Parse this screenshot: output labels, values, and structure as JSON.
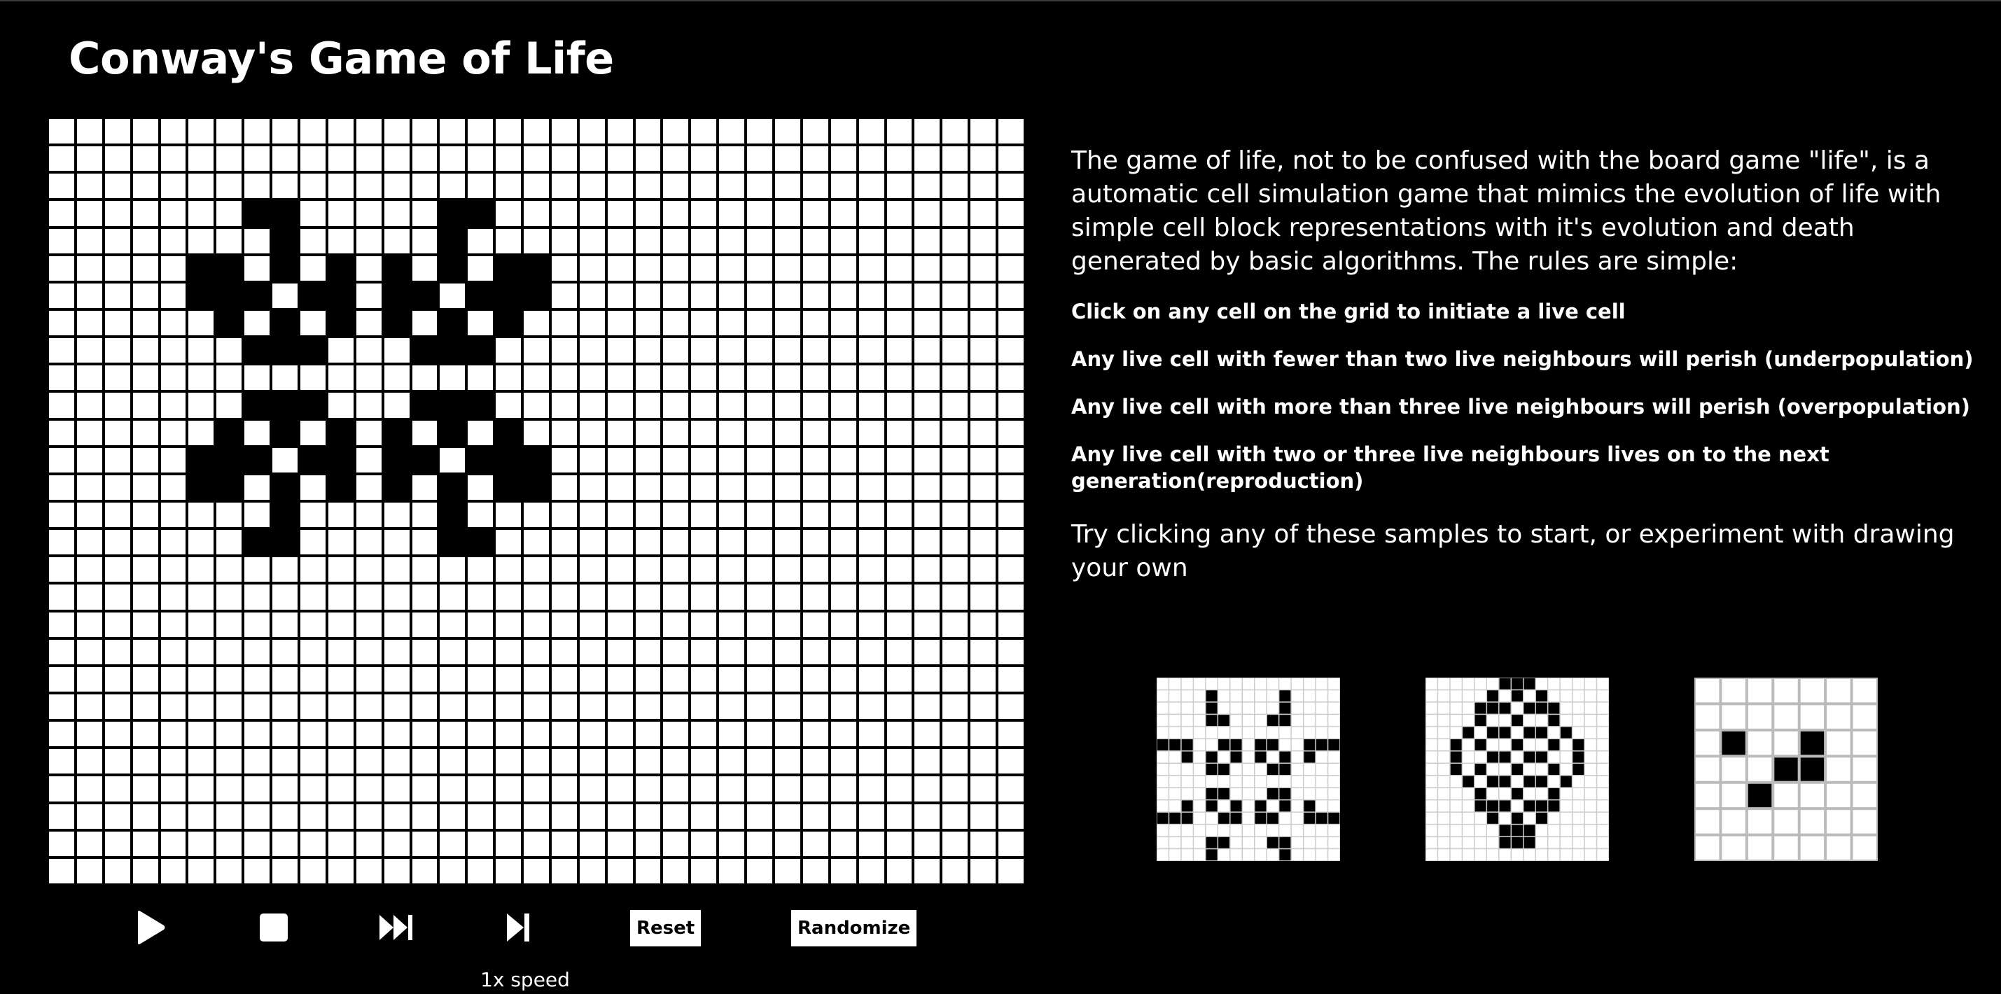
{
  "app": {
    "title": "Conway's Game of Life"
  },
  "board": {
    "cols": 35,
    "rows": 28,
    "live_cells": [
      [
        3,
        7
      ],
      [
        3,
        8
      ],
      [
        3,
        14
      ],
      [
        3,
        15
      ],
      [
        4,
        8
      ],
      [
        4,
        14
      ],
      [
        5,
        5
      ],
      [
        5,
        6
      ],
      [
        5,
        8
      ],
      [
        5,
        10
      ],
      [
        5,
        12
      ],
      [
        5,
        14
      ],
      [
        5,
        16
      ],
      [
        5,
        17
      ],
      [
        6,
        5
      ],
      [
        6,
        6
      ],
      [
        6,
        7
      ],
      [
        6,
        9
      ],
      [
        6,
        10
      ],
      [
        6,
        12
      ],
      [
        6,
        13
      ],
      [
        6,
        15
      ],
      [
        6,
        16
      ],
      [
        6,
        17
      ],
      [
        7,
        6
      ],
      [
        7,
        8
      ],
      [
        7,
        10
      ],
      [
        7,
        12
      ],
      [
        7,
        14
      ],
      [
        7,
        16
      ],
      [
        8,
        7
      ],
      [
        8,
        8
      ],
      [
        8,
        9
      ],
      [
        8,
        13
      ],
      [
        8,
        14
      ],
      [
        8,
        15
      ],
      [
        10,
        7
      ],
      [
        10,
        8
      ],
      [
        10,
        9
      ],
      [
        10,
        13
      ],
      [
        10,
        14
      ],
      [
        10,
        15
      ],
      [
        11,
        6
      ],
      [
        11,
        8
      ],
      [
        11,
        10
      ],
      [
        11,
        12
      ],
      [
        11,
        14
      ],
      [
        11,
        16
      ],
      [
        12,
        5
      ],
      [
        12,
        6
      ],
      [
        12,
        7
      ],
      [
        12,
        9
      ],
      [
        12,
        10
      ],
      [
        12,
        12
      ],
      [
        12,
        13
      ],
      [
        12,
        15
      ],
      [
        12,
        16
      ],
      [
        12,
        17
      ],
      [
        13,
        5
      ],
      [
        13,
        6
      ],
      [
        13,
        8
      ],
      [
        13,
        10
      ],
      [
        13,
        12
      ],
      [
        13,
        14
      ],
      [
        13,
        16
      ],
      [
        13,
        17
      ],
      [
        14,
        8
      ],
      [
        14,
        14
      ],
      [
        15,
        7
      ],
      [
        15,
        8
      ],
      [
        15,
        14
      ],
      [
        15,
        15
      ]
    ]
  },
  "controls": {
    "play_icon": "play-icon",
    "stop_icon": "stop-icon",
    "fast_forward_icon": "fast-forward-icon",
    "step_icon": "step-forward-icon",
    "reset_label": "Reset",
    "randomize_label": "Randomize",
    "speed_label": "1x speed"
  },
  "info": {
    "intro": "The game of life, not to be confused with the board game \"life\", is a automatic cell simulation game that mimics the evolution of life with simple cell block representations with it's evolution and death generated by basic algorithms. The rules are simple:",
    "rules": [
      "Click on any cell on the grid to initiate a live cell",
      "Any live cell with fewer than two live neighbours will perish (underpopulation)",
      "Any live cell with more than three live neighbours will perish (overpopulation)",
      "Any live cell with two or three live neighbours lives on to the next generation(reproduction)"
    ],
    "try_text": "Try clicking any of these samples to start, or experiment with drawing your own"
  },
  "samples": [
    {
      "name": "sample-pulsar",
      "cols": 15,
      "rows": 15,
      "grid_color": "#cccccc",
      "live_cells": [
        [
          1,
          4
        ],
        [
          1,
          10
        ],
        [
          2,
          4
        ],
        [
          2,
          10
        ],
        [
          3,
          4
        ],
        [
          3,
          5
        ],
        [
          3,
          9
        ],
        [
          3,
          10
        ],
        [
          5,
          0
        ],
        [
          5,
          1
        ],
        [
          5,
          2
        ],
        [
          5,
          5
        ],
        [
          5,
          6
        ],
        [
          5,
          8
        ],
        [
          5,
          9
        ],
        [
          5,
          12
        ],
        [
          5,
          13
        ],
        [
          5,
          14
        ],
        [
          6,
          2
        ],
        [
          6,
          4
        ],
        [
          6,
          6
        ],
        [
          6,
          8
        ],
        [
          6,
          10
        ],
        [
          6,
          12
        ],
        [
          7,
          4
        ],
        [
          7,
          5
        ],
        [
          7,
          9
        ],
        [
          7,
          10
        ],
        [
          9,
          4
        ],
        [
          9,
          5
        ],
        [
          9,
          9
        ],
        [
          9,
          10
        ],
        [
          10,
          2
        ],
        [
          10,
          4
        ],
        [
          10,
          6
        ],
        [
          10,
          8
        ],
        [
          10,
          10
        ],
        [
          10,
          12
        ],
        [
          11,
          0
        ],
        [
          11,
          1
        ],
        [
          11,
          2
        ],
        [
          11,
          5
        ],
        [
          11,
          6
        ],
        [
          11,
          8
        ],
        [
          11,
          9
        ],
        [
          11,
          12
        ],
        [
          11,
          13
        ],
        [
          11,
          14
        ],
        [
          13,
          4
        ],
        [
          13,
          5
        ],
        [
          13,
          9
        ],
        [
          13,
          10
        ],
        [
          14,
          4
        ],
        [
          14,
          10
        ]
      ]
    },
    {
      "name": "sample-pentadecathlon",
      "cols": 15,
      "rows": 15,
      "grid_color": "#cccccc",
      "live_cells": [
        [
          0,
          6
        ],
        [
          0,
          7
        ],
        [
          0,
          8
        ],
        [
          1,
          5
        ],
        [
          1,
          7
        ],
        [
          1,
          9
        ],
        [
          2,
          4
        ],
        [
          2,
          5
        ],
        [
          2,
          6
        ],
        [
          2,
          8
        ],
        [
          2,
          9
        ],
        [
          2,
          10
        ],
        [
          3,
          4
        ],
        [
          3,
          7
        ],
        [
          3,
          10
        ],
        [
          4,
          3
        ],
        [
          4,
          5
        ],
        [
          4,
          6
        ],
        [
          4,
          8
        ],
        [
          4,
          9
        ],
        [
          4,
          11
        ],
        [
          5,
          2
        ],
        [
          5,
          4
        ],
        [
          5,
          7
        ],
        [
          5,
          10
        ],
        [
          5,
          12
        ],
        [
          6,
          2
        ],
        [
          6,
          5
        ],
        [
          6,
          6
        ],
        [
          6,
          8
        ],
        [
          6,
          9
        ],
        [
          6,
          12
        ],
        [
          7,
          2
        ],
        [
          7,
          4
        ],
        [
          7,
          7
        ],
        [
          7,
          10
        ],
        [
          7,
          12
        ],
        [
          8,
          3
        ],
        [
          8,
          5
        ],
        [
          8,
          6
        ],
        [
          8,
          8
        ],
        [
          8,
          9
        ],
        [
          8,
          11
        ],
        [
          9,
          4
        ],
        [
          9,
          7
        ],
        [
          9,
          10
        ],
        [
          10,
          4
        ],
        [
          10,
          5
        ],
        [
          10,
          6
        ],
        [
          10,
          8
        ],
        [
          10,
          9
        ],
        [
          10,
          10
        ],
        [
          11,
          5
        ],
        [
          11,
          7
        ],
        [
          11,
          9
        ],
        [
          12,
          6
        ],
        [
          12,
          7
        ],
        [
          12,
          8
        ],
        [
          13,
          6
        ],
        [
          13,
          7
        ],
        [
          13,
          8
        ]
      ]
    },
    {
      "name": "sample-glider",
      "cols": 7,
      "rows": 7,
      "grid_color": "#bbbbbb",
      "live_cells": [
        [
          2,
          1
        ],
        [
          2,
          4
        ],
        [
          3,
          3
        ],
        [
          3,
          4
        ],
        [
          4,
          2
        ]
      ]
    }
  ]
}
